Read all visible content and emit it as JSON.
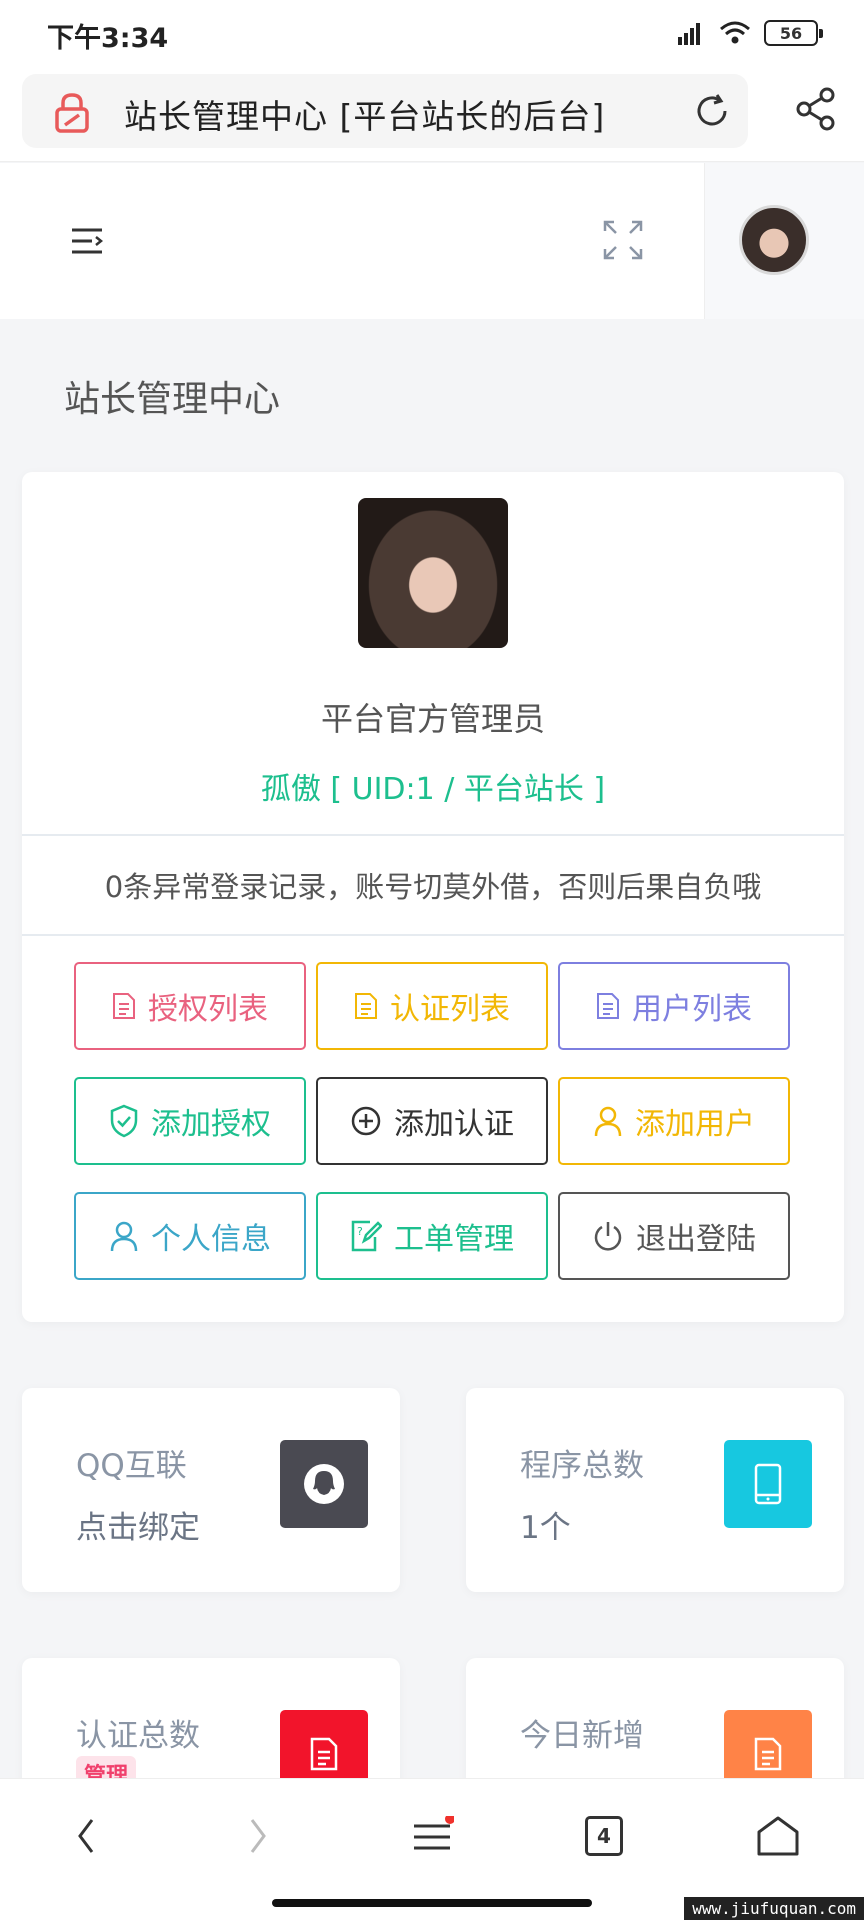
{
  "status_bar": {
    "time": "下午3:34",
    "battery": "56"
  },
  "browser": {
    "title": "站长管理中心 [平台站长的后台]"
  },
  "page": {
    "title": "站长管理中心"
  },
  "profile": {
    "name": "平台官方管理员",
    "uid_text": "孤傲 [ UID:1 / 平台站长 ]",
    "notice": "0条异常登录记录，账号切莫外借，否则后果自负哦"
  },
  "actions": [
    {
      "label": "授权列表",
      "color": "#e9627f",
      "icon": "document-icon"
    },
    {
      "label": "认证列表",
      "color": "#f2b705",
      "icon": "document-icon"
    },
    {
      "label": "用户列表",
      "color": "#7d7fe0",
      "icon": "document-icon"
    },
    {
      "label": "添加授权",
      "color": "#1dbf8e",
      "icon": "shield-check-icon"
    },
    {
      "label": "添加认证",
      "color": "#333333",
      "icon": "plus-circle-icon"
    },
    {
      "label": "添加用户",
      "color": "#f2b705",
      "icon": "user-icon"
    },
    {
      "label": "个人信息",
      "color": "#3ba6c8",
      "icon": "user-icon"
    },
    {
      "label": "工单管理",
      "color": "#1dbf8e",
      "icon": "edit-doc-icon"
    },
    {
      "label": "退出登陆",
      "color": "#555555",
      "icon": "power-icon"
    }
  ],
  "stats": [
    {
      "label": "QQ互联",
      "value": "点击绑定",
      "icon": "qq-icon",
      "color": "#4a4a52"
    },
    {
      "label": "程序总数",
      "value": "1个",
      "icon": "phone-icon",
      "color": "#17c8e0"
    },
    {
      "label": "认证总数",
      "badge": "管理",
      "icon": "document-icon",
      "color": "#f2142b"
    },
    {
      "label": "今日新增",
      "icon": "document-icon",
      "color": "#ff8347"
    }
  ],
  "bottom_nav": {
    "tab_count": "4"
  },
  "watermark": "www.jiufuquan.com"
}
